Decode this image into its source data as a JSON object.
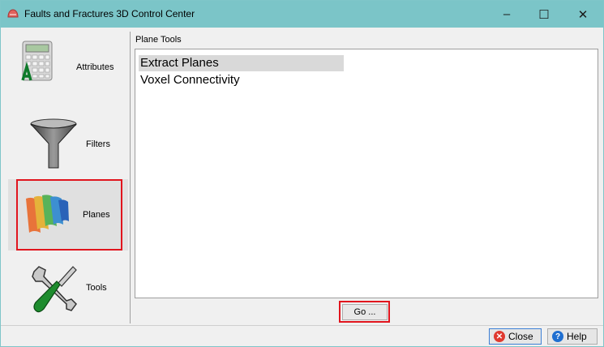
{
  "window": {
    "title": "Faults and Fractures 3D Control Center",
    "minimize_glyph": "–",
    "maximize_glyph": "☐",
    "close_glyph": "✕"
  },
  "sidebar": {
    "items": [
      {
        "label": "Attributes",
        "icon": "calculator-icon"
      },
      {
        "label": "Filters",
        "icon": "funnel-icon"
      },
      {
        "label": "Planes",
        "icon": "planes-icon",
        "selected": true
      },
      {
        "label": "Tools",
        "icon": "wrench-screwdriver-icon"
      }
    ]
  },
  "main": {
    "panel_title": "Plane Tools",
    "list": [
      "Extract Planes",
      "Voxel Connectivity"
    ],
    "selected_index": 0,
    "go_label": "Go ..."
  },
  "footer": {
    "close_label": "Close",
    "help_label": "Help"
  },
  "colors": {
    "titlebar": "#7bc5c8",
    "highlight_frame": "#e1151e",
    "close_icon": "#e03a2f",
    "help_icon": "#1f6fd1"
  }
}
